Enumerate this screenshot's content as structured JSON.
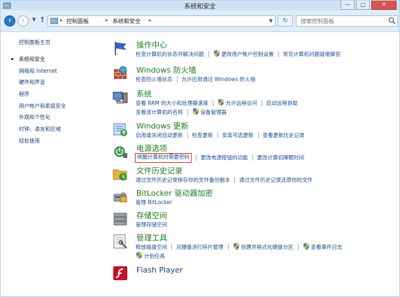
{
  "window": {
    "title": "系统和安全",
    "minimize": "—",
    "maximize": "□",
    "close": "✕"
  },
  "nav": {
    "breadcrumb": [
      "控制面板",
      "系统和安全"
    ],
    "search_placeholder": "搜索控制面板"
  },
  "sidebar": {
    "items": [
      {
        "label": "控制面板主页",
        "current": false
      },
      {
        "label": "系统和安全",
        "current": true
      },
      {
        "label": "网络和 Internet",
        "current": false
      },
      {
        "label": "硬件和声音",
        "current": false
      },
      {
        "label": "程序",
        "current": false
      },
      {
        "label": "用户帐户和家庭安全",
        "current": false
      },
      {
        "label": "外观和个性化",
        "current": false
      },
      {
        "label": "时钟、语言和区域",
        "current": false
      },
      {
        "label": "轻松使用",
        "current": false
      }
    ]
  },
  "categories": [
    {
      "title": "操作中心",
      "icon": "flag-icon",
      "links": [
        "检查计算机的状态并解决问题",
        "更改用户帐户控制设置",
        "常见计算机问题疑难解答"
      ]
    },
    {
      "title": "Windows 防火墙",
      "icon": "firewall-icon",
      "links": [
        "检查防火墙状态",
        "允许应用通过 Windows 防火墙"
      ]
    },
    {
      "title": "系统",
      "icon": "computer-icon",
      "links": [
        "查看 RAM 的大小和处理器速度",
        "允许远程访问",
        "启动远程协助",
        "查看该计算机的名称",
        "设备管理器"
      ]
    },
    {
      "title": "Windows 更新",
      "icon": "update-icon",
      "links": [
        "启用或关闭自动更新",
        "检查更新",
        "安装可选更新",
        "查看更新历史记录"
      ]
    },
    {
      "title": "电源选项",
      "icon": "power-icon",
      "links": [
        "唤醒计算机时需要密码",
        "更改电源按钮的功能",
        "更改计算机睡眠时间"
      ]
    },
    {
      "title": "文件历史记录",
      "icon": "file-history-icon",
      "links": [
        "通过文件历史记录保存你的文件备份副本",
        "通过文件历史记录还原你的文件"
      ]
    },
    {
      "title": "BitLocker 驱动器加密",
      "icon": "bitlocker-icon",
      "links": [
        "管理 BitLocker"
      ]
    },
    {
      "title": "存储空间",
      "icon": "storage-icon",
      "links": [
        "管理存储空间"
      ]
    },
    {
      "title": "管理工具",
      "icon": "admin-tools-icon",
      "links": [
        "释放磁盘空间",
        "对硬盘进行碎片整理",
        "创建并格式化硬盘分区",
        "查看事件日志",
        "计划任务"
      ]
    },
    {
      "title": "Flash Player",
      "icon": "flash-icon",
      "links": []
    }
  ],
  "colors": {
    "title_green": "#1e7b1e",
    "link_blue": "#1a4d8f",
    "highlight_box": "#dd3333",
    "nav_bg": "#dfedf9"
  }
}
